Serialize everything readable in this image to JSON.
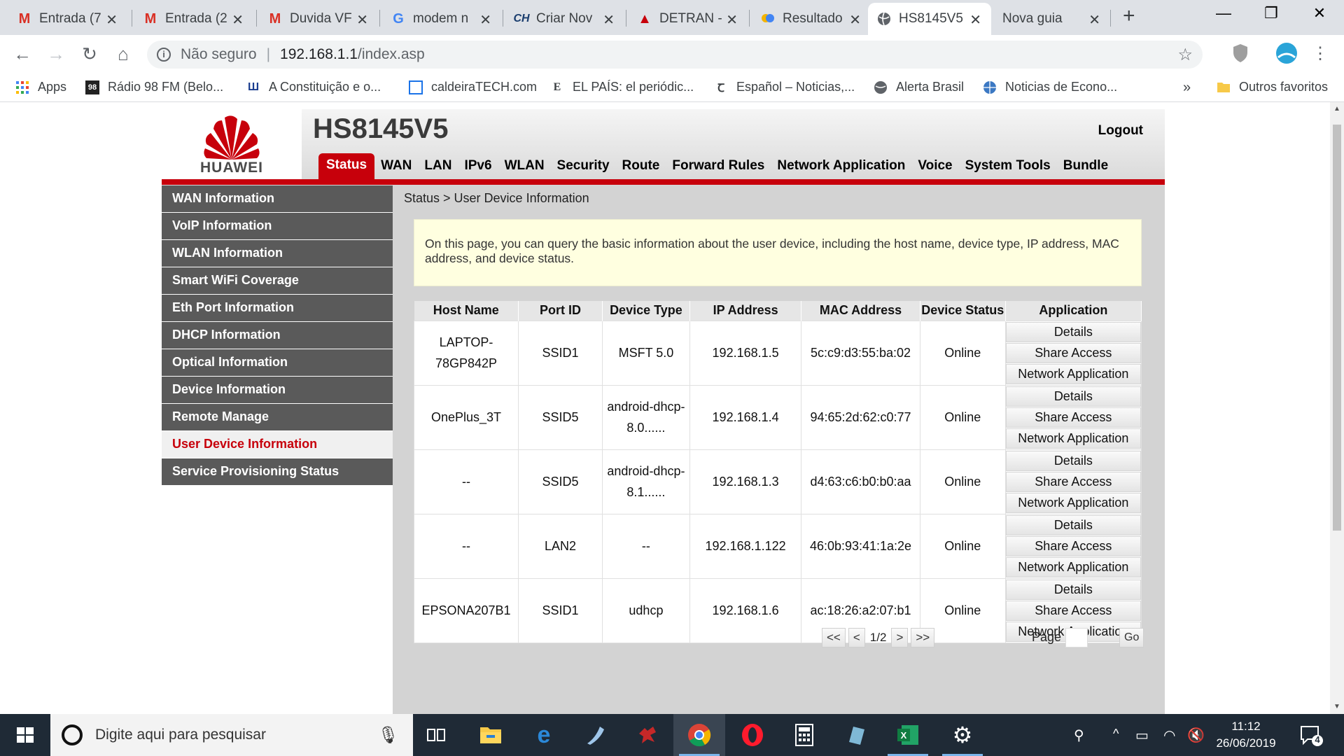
{
  "browser": {
    "tabs": [
      {
        "title": "Entrada (7",
        "icon": "gmail-icon"
      },
      {
        "title": "Entrada (2",
        "icon": "gmail-icon"
      },
      {
        "title": "Duvida VF",
        "icon": "gmail-icon"
      },
      {
        "title": "modem n",
        "icon": "google-icon"
      },
      {
        "title": "Criar Nov",
        "icon": "clube-hardware-icon"
      },
      {
        "title": "DETRAN -",
        "icon": "detran-icon"
      },
      {
        "title": "Resultado",
        "icon": "search-result-icon"
      },
      {
        "title": "HS8145V5",
        "icon": "globe-icon",
        "active": true
      },
      {
        "title": "Nova guia",
        "icon": ""
      }
    ],
    "address": {
      "security_label": "Não seguro",
      "host": "192.168.1.1",
      "path": "/index.asp"
    },
    "bookmarks": [
      {
        "label": "Apps",
        "icon": "apps-grid-icon"
      },
      {
        "label": "Rádio 98 FM (Belo...",
        "icon": "radio-icon"
      },
      {
        "label": "A Constituição e o...",
        "icon": "constitution-icon"
      },
      {
        "label": "caldeiraTECH.com",
        "icon": "page-icon"
      },
      {
        "label": "EL PAÍS: el periódic...",
        "icon": "el-pais-icon"
      },
      {
        "label": "Español – Noticias,...",
        "icon": "newspaper-icon"
      },
      {
        "label": "Alerta Brasil",
        "icon": "globe-icon"
      },
      {
        "label": "Noticias de Econo...",
        "icon": "world-icon"
      }
    ],
    "overflow_label": "»",
    "other_bookmarks": "Outros favoritos"
  },
  "router": {
    "brand": "HUAWEI",
    "model": "HS8145V5",
    "logout": "Logout",
    "nav": [
      {
        "label": "Status",
        "active": true
      },
      {
        "label": "WAN"
      },
      {
        "label": "LAN"
      },
      {
        "label": "IPv6"
      },
      {
        "label": "WLAN"
      },
      {
        "label": "Security"
      },
      {
        "label": "Route"
      },
      {
        "label": "Forward Rules"
      },
      {
        "label": "Network Application"
      },
      {
        "label": "Voice"
      },
      {
        "label": "System Tools"
      },
      {
        "label": "Bundle"
      }
    ],
    "sidebar": [
      {
        "label": "WAN Information"
      },
      {
        "label": "VoIP Information"
      },
      {
        "label": "WLAN Information"
      },
      {
        "label": "Smart WiFi Coverage"
      },
      {
        "label": "Eth Port Information"
      },
      {
        "label": "DHCP Information"
      },
      {
        "label": "Optical Information"
      },
      {
        "label": "Device Information"
      },
      {
        "label": "Remote Manage"
      },
      {
        "label": "User Device Information",
        "active": true
      },
      {
        "label": "Service Provisioning Status"
      }
    ],
    "breadcrumb": "Status > User Device Information",
    "notice": "On this page, you can query the basic information about the user device, including the host name, device type, IP address, MAC address, and device status.",
    "table": {
      "headers": [
        "Host Name",
        "Port ID",
        "Device Type",
        "IP Address",
        "MAC Address",
        "Device Status",
        "Application"
      ],
      "rows": [
        {
          "host": "LAPTOP-78GP842P",
          "port": "SSID1",
          "type": "MSFT 5.0",
          "ip": "192.168.1.5",
          "mac": "5c:c9:d3:55:ba:02",
          "status": "Online"
        },
        {
          "host": "OnePlus_3T",
          "port": "SSID5",
          "type": "android-dhcp-8.0......",
          "ip": "192.168.1.4",
          "mac": "94:65:2d:62:c0:77",
          "status": "Online"
        },
        {
          "host": "--",
          "port": "SSID5",
          "type": "android-dhcp-8.1......",
          "ip": "192.168.1.3",
          "mac": "d4:63:c6:b0:b0:aa",
          "status": "Online"
        },
        {
          "host": "--",
          "port": "LAN2",
          "type": "--",
          "ip": "192.168.1.122",
          "mac": "46:0b:93:41:1a:2e",
          "status": "Online"
        },
        {
          "host": "EPSONA207B1",
          "port": "SSID1",
          "type": "udhcp",
          "ip": "192.168.1.6",
          "mac": "ac:18:26:a2:07:b1",
          "status": "Online"
        }
      ],
      "app_buttons": [
        "Details",
        "Share Access",
        "Network Application"
      ]
    },
    "pager": {
      "first": "<<",
      "prev": "<",
      "info": "1/2",
      "next": ">",
      "last": ">>",
      "page_label": "Page",
      "go": "Go"
    }
  },
  "taskbar": {
    "search_placeholder": "Digite aqui para pesquisar",
    "time": "11:12",
    "date": "26/06/2019",
    "notifications": "4",
    "apps": [
      "task-view-icon",
      "file-explorer-icon",
      "edge-icon",
      "app-icon",
      "game-icon",
      "chrome-icon",
      "opera-icon",
      "calculator-icon",
      "app-icon",
      "excel-icon",
      "settings-icon"
    ]
  },
  "colors": {
    "huawei_red": "#c7000b",
    "sidebar_gray": "#5a5a5a",
    "notice_bg": "#ffffe0",
    "taskbar": "#1f2a36"
  }
}
